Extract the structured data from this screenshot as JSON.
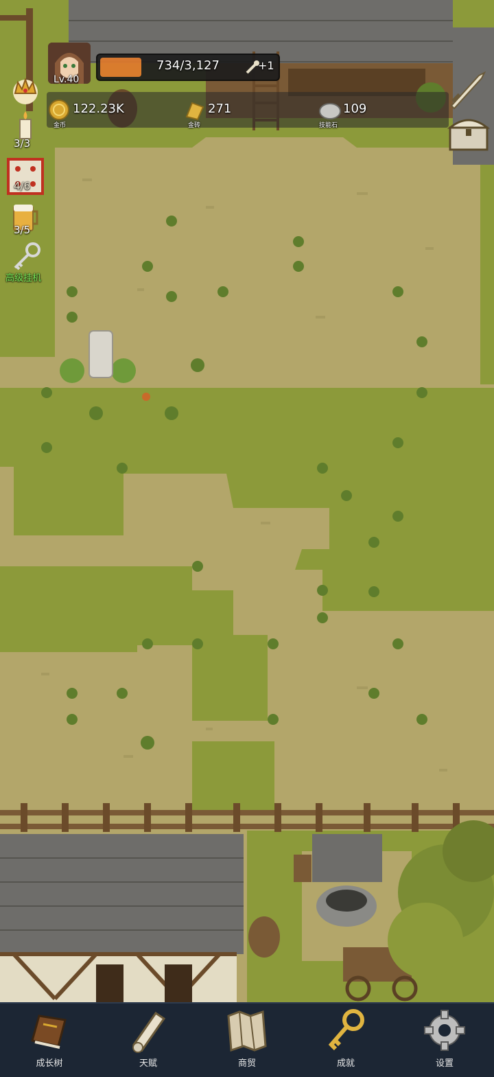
{
  "player": {
    "level": "Lv.40",
    "exp_text": "734/3,127",
    "exp_fraction": 0.235,
    "stamina_bonus": "+1"
  },
  "resources": [
    {
      "icon": "gold-coin-icon",
      "value": "122.23K",
      "label": "金币"
    },
    {
      "icon": "gold-brick-icon",
      "value": "271",
      "label": "金砖"
    },
    {
      "icon": "skill-stone-icon",
      "value": "109",
      "label": "技能石"
    }
  ],
  "side_items": [
    {
      "icon": "crown-icon",
      "count": ""
    },
    {
      "icon": "candle-icon",
      "count": "3/3"
    },
    {
      "icon": "dice-icon",
      "count": "4/6"
    },
    {
      "icon": "beer-mug-icon",
      "count": "3/5"
    },
    {
      "icon": "key-icon",
      "label": "高级挂机"
    }
  ],
  "nav": [
    {
      "label": "成长树",
      "icon": "book-icon"
    },
    {
      "label": "天赋",
      "icon": "scroll-icon"
    },
    {
      "label": "商贸",
      "icon": "map-icon"
    },
    {
      "label": "成就",
      "icon": "golden-key-icon"
    },
    {
      "label": "设置",
      "icon": "gear-icon"
    }
  ],
  "colors": {
    "dirt": "#b3a66a",
    "grass": "#8c9a3a",
    "roof": "#6e6d6a",
    "exp_bar": "#e07a2c",
    "nav_bg": "#1c2634",
    "idle_text": "#7cf05a"
  }
}
